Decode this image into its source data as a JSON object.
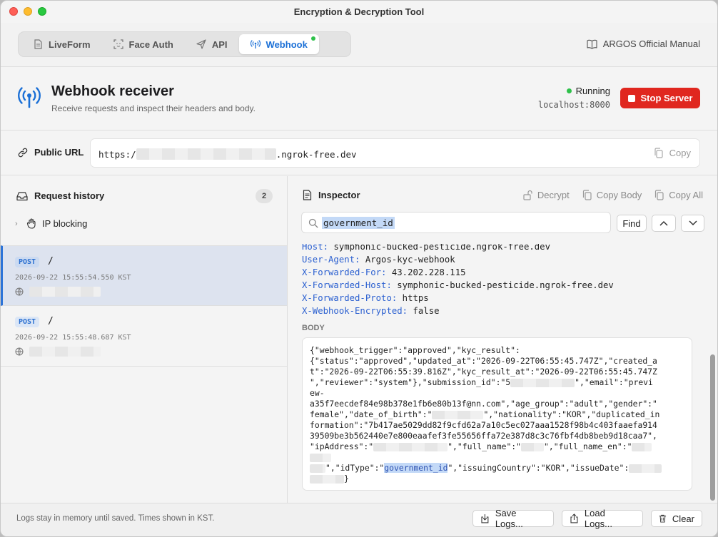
{
  "window": {
    "title": "Encryption & Decryption Tool"
  },
  "tabs": [
    {
      "label": "LiveForm",
      "icon": "document-icon"
    },
    {
      "label": "Face Auth",
      "icon": "face-scan-icon"
    },
    {
      "label": "API",
      "icon": "paper-plane-icon"
    },
    {
      "label": "Webhook",
      "icon": "antenna-icon",
      "active": true
    }
  ],
  "manual": {
    "label": "ARGOS Official Manual"
  },
  "header": {
    "title": "Webhook receiver",
    "subtitle": "Receive requests and inspect their headers and body.",
    "status": "Running",
    "host": "localhost:8000",
    "stop_label": "Stop Server"
  },
  "public_url": {
    "label": "Public URL",
    "prefix": "https:/",
    "suffix": ".ngrok-free.dev",
    "copy_label": "Copy"
  },
  "history": {
    "title": "Request history",
    "count": "2",
    "ip_blocking": "IP blocking",
    "requests": [
      {
        "method": "POST",
        "path": "/",
        "timestamp": "2026-09-22 15:55:54.550 KST"
      },
      {
        "method": "POST",
        "path": "/",
        "timestamp": "2026-09-22 15:55:48.687 KST"
      }
    ]
  },
  "inspector": {
    "title": "Inspector",
    "decrypt_label": "Decrypt",
    "copy_body_label": "Copy Body",
    "copy_all_label": "Copy All",
    "search_value": "government_id",
    "find_label": "Find",
    "headers": [
      {
        "key": "Host:",
        "value": "symphonic-bucked-pesticide.ngrok-free.dev"
      },
      {
        "key": "User-Agent:",
        "value": "Argos-kyc-webhook"
      },
      {
        "key": "X-Forwarded-For:",
        "value": "43.202.228.115"
      },
      {
        "key": "X-Forwarded-Host:",
        "value": "symphonic-bucked-pesticide.ngrok-free.dev"
      },
      {
        "key": "X-Forwarded-Proto:",
        "value": "https"
      },
      {
        "key": "X-Webhook-Encrypted:",
        "value": "false"
      }
    ],
    "body_label": "BODY",
    "body_lines": [
      "{\"webhook_trigger\":\"approved\",\"kyc_result\":",
      "{\"status\":\"approved\",\"updated_at\":\"2026-09-22T06:55:45.747Z\",\"created_a",
      "t\":\"2026-09-22T06:55:39.816Z\",\"kyc_result_at\":\"2026-09-22T06:55:45.747Z",
      "\",\"reviewer\":\"system\"},\"submission_id\":\"5",
      "\",\"email\":\"previ",
      "ew-",
      "a35f7eecdef84e98b378e1fb6e80b13f@nn.com\",\"age_group\":\"adult\",\"gender\":\"",
      "female\",\"date_of_birth\":\"",
      "\",\"nationality\":\"KOR\",\"duplicated_in",
      "formation\":\"7b417ae5029dd82f9cfd62a7a10c5ec027aaa1528f98b4c403faaefa914",
      "39509be3b562440e7e800eaafef3fe55656ffa72e387d8c3c76fbf4db8beb9d18caa7\",",
      "\"ipAddress\":\"",
      "\",\"full_name\":\"",
      "\",\"full_name_en\":\"",
      "\",\"idType\":\"",
      "government_id",
      "\",\"issuingCountry\":\"KOR\",\"issueDate\":",
      "}"
    ]
  },
  "footer": {
    "note": "Logs stay in memory until saved. Times shown in KST.",
    "save_label": "Save Logs...",
    "load_label": "Load Logs...",
    "clear_label": "Clear"
  },
  "colors": {
    "accent": "#1a6fd6",
    "stop": "#e0271f",
    "running": "#2ec14a"
  }
}
